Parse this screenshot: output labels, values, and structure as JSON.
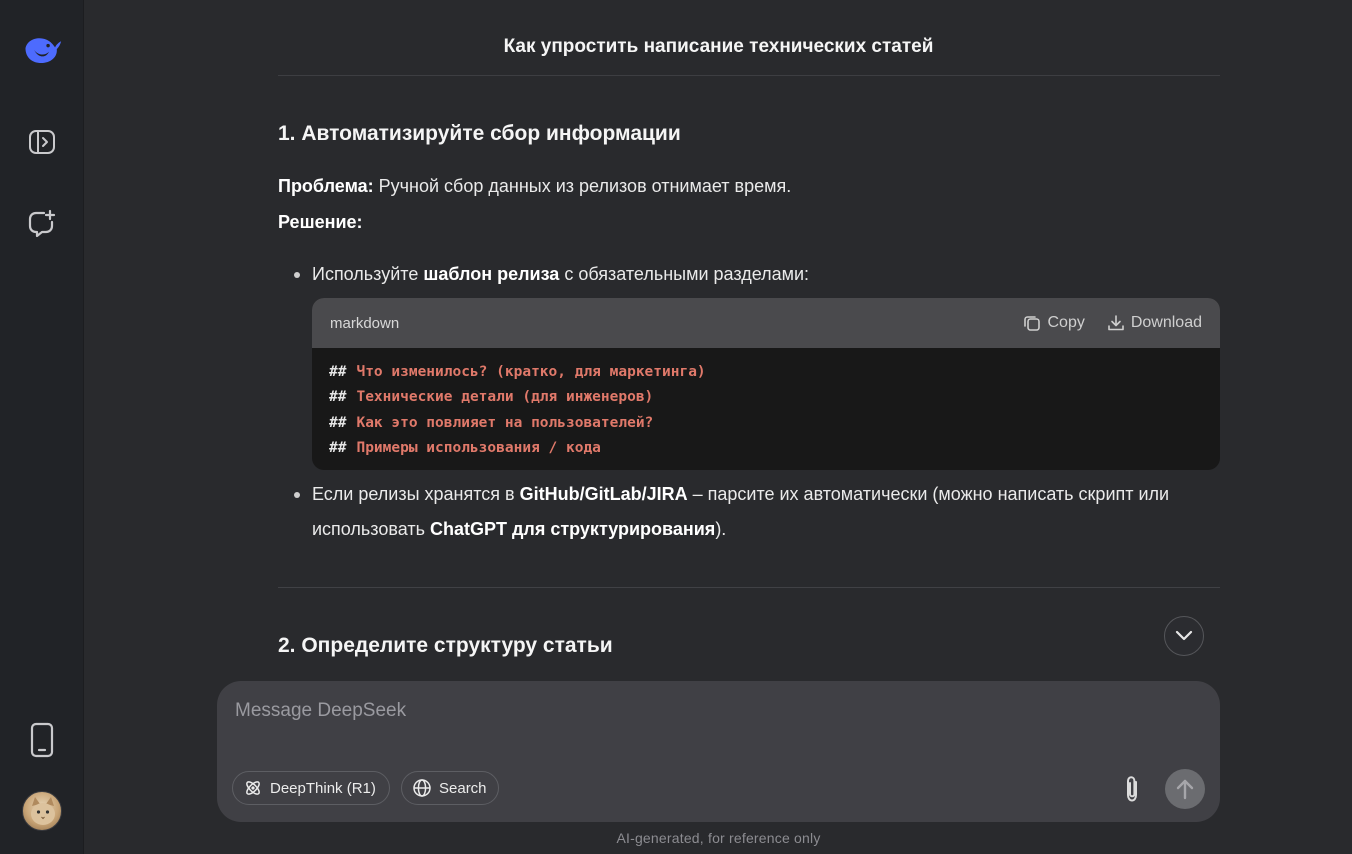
{
  "sidebar": {
    "logo_icon": "deepseek-whale-logo",
    "toggle_icon": "sidebar-toggle-icon",
    "new_chat_icon": "new-chat-icon",
    "phone_icon": "mobile-app-icon",
    "avatar": "user-avatar"
  },
  "header": {
    "title": "Как упростить написание технических статей"
  },
  "content": {
    "section1_heading": "1. Автоматизируйте сбор информации",
    "problem_label": "Проблема:",
    "problem_text": " Ручной сбор данных из релизов отнимает время.",
    "solution_label": "Решение:",
    "bullet1_pre": "Используйте ",
    "bullet1_bold": "шаблон релиза",
    "bullet1_post": " с обязательными разделами:",
    "code": {
      "language": "markdown",
      "copy_label": "Copy",
      "download_label": "Download",
      "lines": [
        {
          "hash": "##",
          "text": "Что изменилось? (кратко, для маркетинга)"
        },
        {
          "hash": "##",
          "text": "Технические детали (для инженеров)"
        },
        {
          "hash": "##",
          "text": "Как это повлияет на пользователей?"
        },
        {
          "hash": "##",
          "text": "Примеры использования / кода"
        }
      ]
    },
    "bullet2_pre": "Если релизы хранятся в ",
    "bullet2_bold1": "GitHub/GitLab/JIRA",
    "bullet2_mid": " – парсите их автоматически (можно написать скрипт или использовать ",
    "bullet2_bold2": "ChatGPT для структурирования",
    "bullet2_post": ").",
    "section2_heading": "2. Определите структуру статьи"
  },
  "composer": {
    "placeholder": "Message DeepSeek",
    "deepthink_label": "DeepThink (R1)",
    "search_label": "Search"
  },
  "footer": {
    "note": "AI-generated, for reference only"
  },
  "colors": {
    "accent": "#4d6bfe",
    "background": "#292a2d",
    "sidebar": "#212327",
    "code_text": "#e0796a"
  }
}
